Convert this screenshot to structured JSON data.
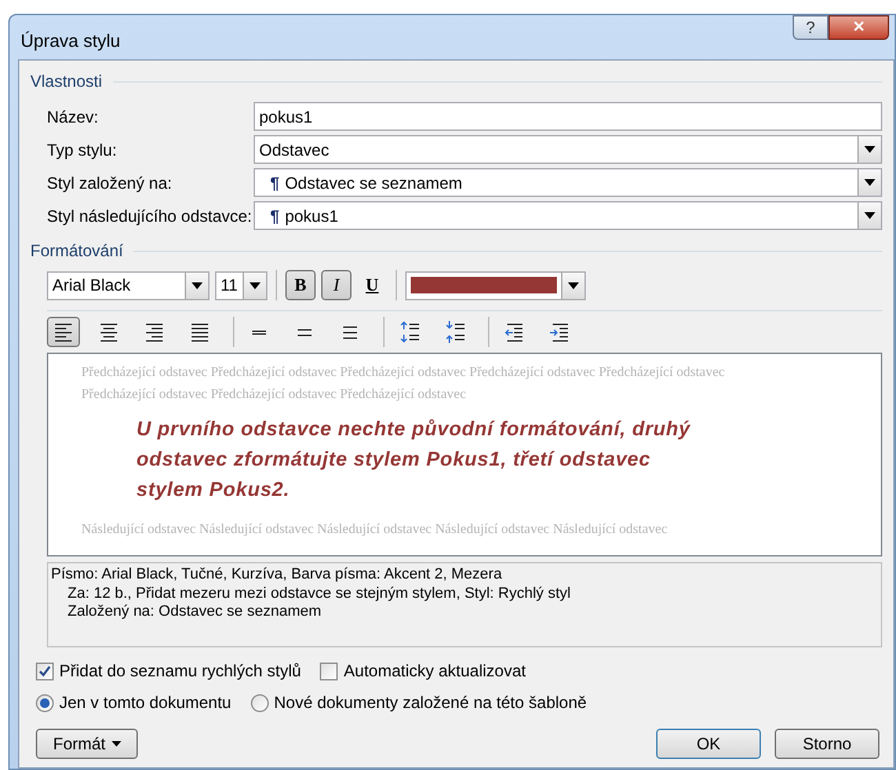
{
  "window": {
    "title": "Úprava stylu",
    "help": "?",
    "close": "✕"
  },
  "properties": {
    "title": "Vlastnosti",
    "fields": [
      {
        "kind": "text",
        "label": "Název:",
        "value": "pokus1"
      },
      {
        "kind": "select",
        "label": "Typ stylu:",
        "value": "Odstavec"
      },
      {
        "kind": "select",
        "label": "Styl založený na:",
        "value": "Odstavec se seznamem",
        "para_mark": "¶"
      },
      {
        "kind": "select",
        "label": "Styl následujícího odstavce:",
        "value": "pokus1",
        "para_mark": "¶"
      }
    ]
  },
  "formatting": {
    "title": "Formátování",
    "font": "Arial Black",
    "size": "11",
    "styles": [
      {
        "kind": "bold",
        "label": "B",
        "selected": true
      },
      {
        "kind": "italic",
        "label": "I",
        "selected": true
      },
      {
        "kind": "underline",
        "label": "U",
        "selected": false
      }
    ],
    "color": "#953735",
    "paragraph_buttons": [
      {
        "kind": "align-left",
        "selected": true
      },
      {
        "kind": "align-center",
        "selected": false
      },
      {
        "kind": "align-right",
        "selected": false
      },
      {
        "kind": "justify",
        "selected": false
      },
      {
        "kind": "single",
        "selected": false
      },
      {
        "kind": "one-half",
        "selected": false
      },
      {
        "kind": "double",
        "selected": false
      },
      {
        "kind": "space-more",
        "selected": false
      },
      {
        "kind": "space-less",
        "selected": false
      },
      {
        "kind": "indent-less",
        "selected": false
      },
      {
        "kind": "indent-more",
        "selected": false
      }
    ]
  },
  "preview": {
    "previous": "Předcházející odstavec Předcházející odstavec Předcházející odstavec Předcházející odstavec Předcházející odstavec Předcházející odstavec Předcházející odstavec Předcházející odstavec",
    "sample": "U prvního odstavce nechte původní formátování, druhý odstavec zformátujte stylem Pokus1, třetí odstavec stylem Pokus2.",
    "next": "Následující odstavec Následující odstavec Následující odstavec Následující odstavec Následující odstavec"
  },
  "description": [
    "Písmo: Arial Black, Tučné, Kurzíva, Barva písma: Akcent 2, Mezera",
    "Za:  12 b., Přidat mezeru mezi odstavce se stejným stylem, Styl: Rychlý styl",
    "Založený na: Odstavec se seznamem"
  ],
  "checkboxes": [
    {
      "label": "Přidat do seznamu rychlých stylů",
      "checked": true
    },
    {
      "label": "Automaticky aktualizovat",
      "checked": false
    }
  ],
  "radios": [
    {
      "label": "Jen v tomto dokumentu",
      "selected": true
    },
    {
      "label": "Nové dokumenty založené na této šabloně",
      "selected": false
    }
  ],
  "format_button": "Formát",
  "buttons": [
    "OK",
    "Storno"
  ]
}
